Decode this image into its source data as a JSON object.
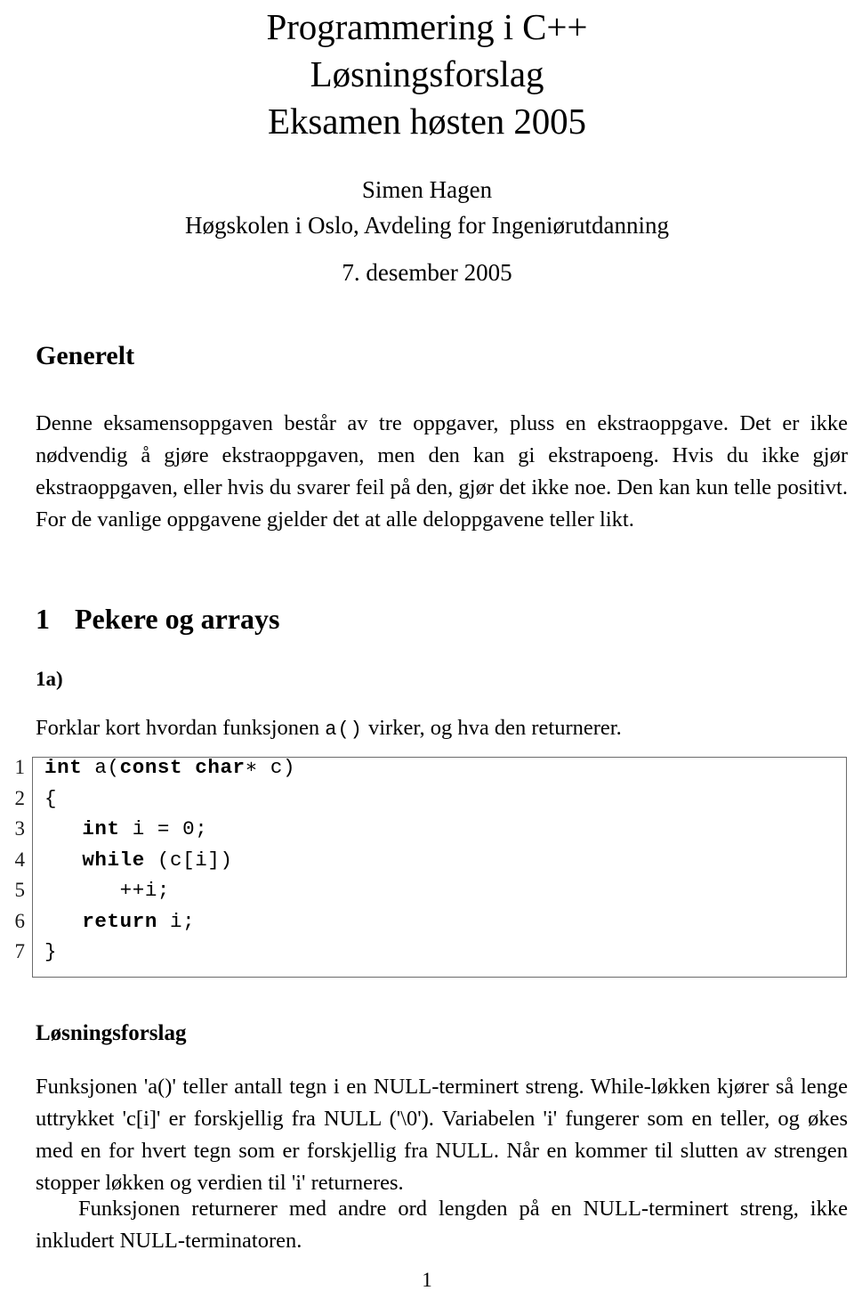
{
  "document": {
    "title_lines": [
      "Programmering i C++",
      "Løsningsforslag",
      "Eksamen høsten 2005"
    ],
    "author": "Simen Hagen",
    "affiliation": "Høgskolen i Oslo, Avdeling for Ingeniørutdanning",
    "date": "7. desember 2005",
    "page_number": "1"
  },
  "sections": {
    "generelt": {
      "heading": "Generelt",
      "body": "Denne eksamensoppgaven består av tre oppgaver, pluss en ekstraoppgave. Det er ikke nødvendig å gjøre ekstraoppgaven, men den kan gi ekstrapoeng. Hvis du ikke gjør ekstraoppgaven, eller hvis du svarer feil på den, gjør det ikke noe. Den kan kun telle positivt. For de vanlige oppgavene gjelder det at alle deloppgavene teller likt."
    },
    "pekere_og_arrays": {
      "number": "1",
      "heading": "Pekere og arrays",
      "subheading": "1a)",
      "prompt_before": "Forklar kort hvordan funksjonen ",
      "prompt_code": "a()",
      "prompt_after": " virker, og hva den returnerer."
    },
    "solution": {
      "heading": "Løsningsforslag",
      "paragraph_1": "Funksjonen 'a()' teller antall tegn i en NULL-terminert streng. While-løkken kjører så lenge uttrykket 'c[i]' er forskjellig fra NULL ('\\0'). Variabelen 'i' fungerer som en teller, og økes med en for hvert tegn som er forskjellig fra NULL. Når en kommer til slutten av strengen stopper løkken og verdien til 'i' returneres.",
      "paragraph_2": "Funksjonen returnerer med andre ord lengden på en NULL-terminert streng, ikke inkludert NULL-terminatoren."
    }
  },
  "code_listing": {
    "language": "C++",
    "lines": [
      {
        "number": "1",
        "html": "<b>int</b> a(<b>const</b> <b>char</b>&#8727; c)"
      },
      {
        "number": "2",
        "html": "{"
      },
      {
        "number": "3",
        "html": "   <b>int</b> i = 0;"
      },
      {
        "number": "4",
        "html": "   <b>while</b> (c[i])"
      },
      {
        "number": "5",
        "html": "      ++i;"
      },
      {
        "number": "6",
        "html": "   <b>return</b> i;"
      },
      {
        "number": "7",
        "html": "}"
      }
    ]
  },
  "style": {
    "text_color": "#000000",
    "background_color": "#ffffff",
    "listing_border_color": "#6b6b6b"
  }
}
